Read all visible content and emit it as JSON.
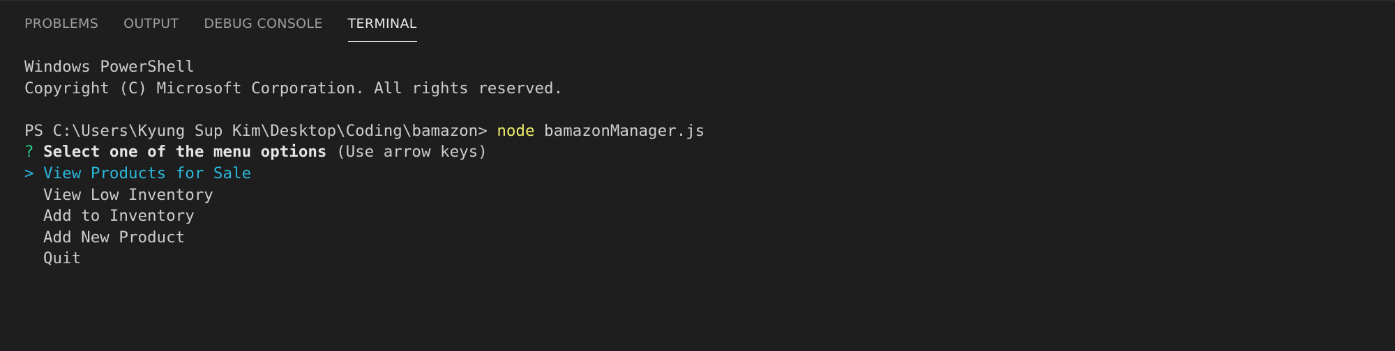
{
  "tabs": [
    {
      "label": "PROBLEMS"
    },
    {
      "label": "OUTPUT"
    },
    {
      "label": "DEBUG CONSOLE"
    },
    {
      "label": "TERMINAL"
    }
  ],
  "active_tab": "TERMINAL",
  "terminal": {
    "line1": "Windows PowerShell",
    "line2": "Copyright (C) Microsoft Corporation. All rights reserved.",
    "prompt": "PS C:\\Users\\Kyung Sup Kim\\Desktop\\Coding\\bamazon> ",
    "command": "node",
    "command_arg": " bamazonManager.js",
    "question_mark": "?",
    "question": "Select one of the menu options",
    "hint": " (Use arrow keys)",
    "pointer": ">",
    "menu_items": [
      "View Products for Sale",
      "View Low Inventory",
      "Add to Inventory",
      "Add New Product",
      "Quit"
    ]
  },
  "colors": {
    "background": "#1e1e1e",
    "command": "#ecec6b",
    "question_mark": "#23d18b",
    "selected_item": "#29b8db"
  }
}
